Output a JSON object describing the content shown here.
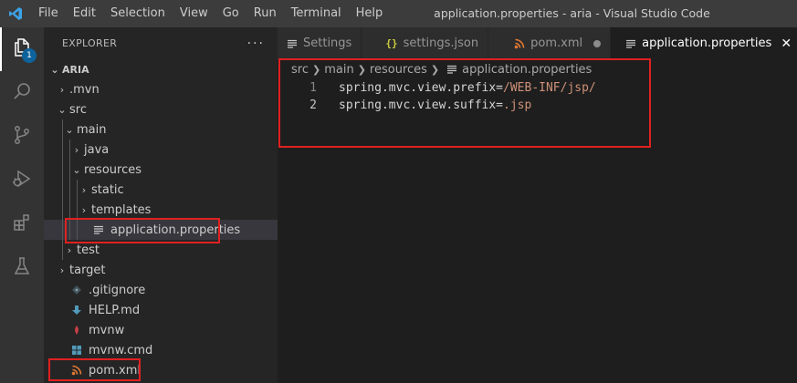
{
  "window": {
    "title": "application.properties - aria - Visual Studio Code"
  },
  "menu": [
    "File",
    "Edit",
    "Selection",
    "View",
    "Go",
    "Run",
    "Terminal",
    "Help"
  ],
  "activity_bar": {
    "explorer_badge": "1",
    "items": [
      "files-icon",
      "search-icon",
      "source-control-icon",
      "run-debug-icon",
      "extensions-icon",
      "testing-icon"
    ]
  },
  "sidebar": {
    "header": "EXPLORER",
    "more": "···",
    "tree": [
      {
        "label": "ARIA",
        "depth": 0,
        "chevron": "⌄",
        "icon": "",
        "kind": "root"
      },
      {
        "label": ".mvn",
        "depth": 1,
        "chevron": "›",
        "icon": ""
      },
      {
        "label": "src",
        "depth": 1,
        "chevron": "⌄",
        "icon": ""
      },
      {
        "label": "main",
        "depth": 2,
        "chevron": "⌄",
        "icon": ""
      },
      {
        "label": "java",
        "depth": 3,
        "chevron": "›",
        "icon": ""
      },
      {
        "label": "resources",
        "depth": 3,
        "chevron": "⌄",
        "icon": ""
      },
      {
        "label": "static",
        "depth": 4,
        "chevron": "›",
        "icon": ""
      },
      {
        "label": "templates",
        "depth": 4,
        "chevron": "›",
        "icon": ""
      },
      {
        "label": "application.properties",
        "depth": 4,
        "chevron": "",
        "icon": "lines-icon",
        "selected": true
      },
      {
        "label": "test",
        "depth": 2,
        "chevron": "›",
        "icon": ""
      },
      {
        "label": "target",
        "depth": 1,
        "chevron": "›",
        "icon": ""
      },
      {
        "label": ".gitignore",
        "depth": 1,
        "chevron": "",
        "icon": "gitignore-icon"
      },
      {
        "label": "HELP.md",
        "depth": 1,
        "chevron": "",
        "icon": "markdown-icon"
      },
      {
        "label": "mvnw",
        "depth": 1,
        "chevron": "",
        "icon": "ruby-icon"
      },
      {
        "label": "mvnw.cmd",
        "depth": 1,
        "chevron": "",
        "icon": "windows-icon"
      },
      {
        "label": "pom.xml",
        "depth": 1,
        "chevron": "",
        "icon": "rss-icon"
      }
    ]
  },
  "tabs": [
    {
      "label": "Settings",
      "icon": "lines-icon",
      "active": false
    },
    {
      "label": "settings.json",
      "icon": "json-icon",
      "active": false
    },
    {
      "label": "pom.xml",
      "icon": "rss-icon",
      "active": false,
      "dirty": true
    },
    {
      "label": "application.properties",
      "icon": "lines-icon",
      "active": true,
      "close": "✕"
    }
  ],
  "breadcrumb": [
    "src",
    "main",
    "resources",
    "application.properties"
  ],
  "editor": {
    "lines": [
      {
        "number": "1",
        "key": "spring.mvc.view.prefix=",
        "value": "/WEB-INF/jsp/"
      },
      {
        "number": "2",
        "key": "spring.mvc.view.suffix=",
        "value": ".jsp"
      }
    ]
  },
  "colors": {
    "accent": "#0e639c",
    "highlight": "#e02020",
    "string_value": "#ce9178",
    "rss": "#e37933",
    "markdown": "#519aba",
    "ruby": "#cc3e44",
    "json": "#cbcb41"
  }
}
